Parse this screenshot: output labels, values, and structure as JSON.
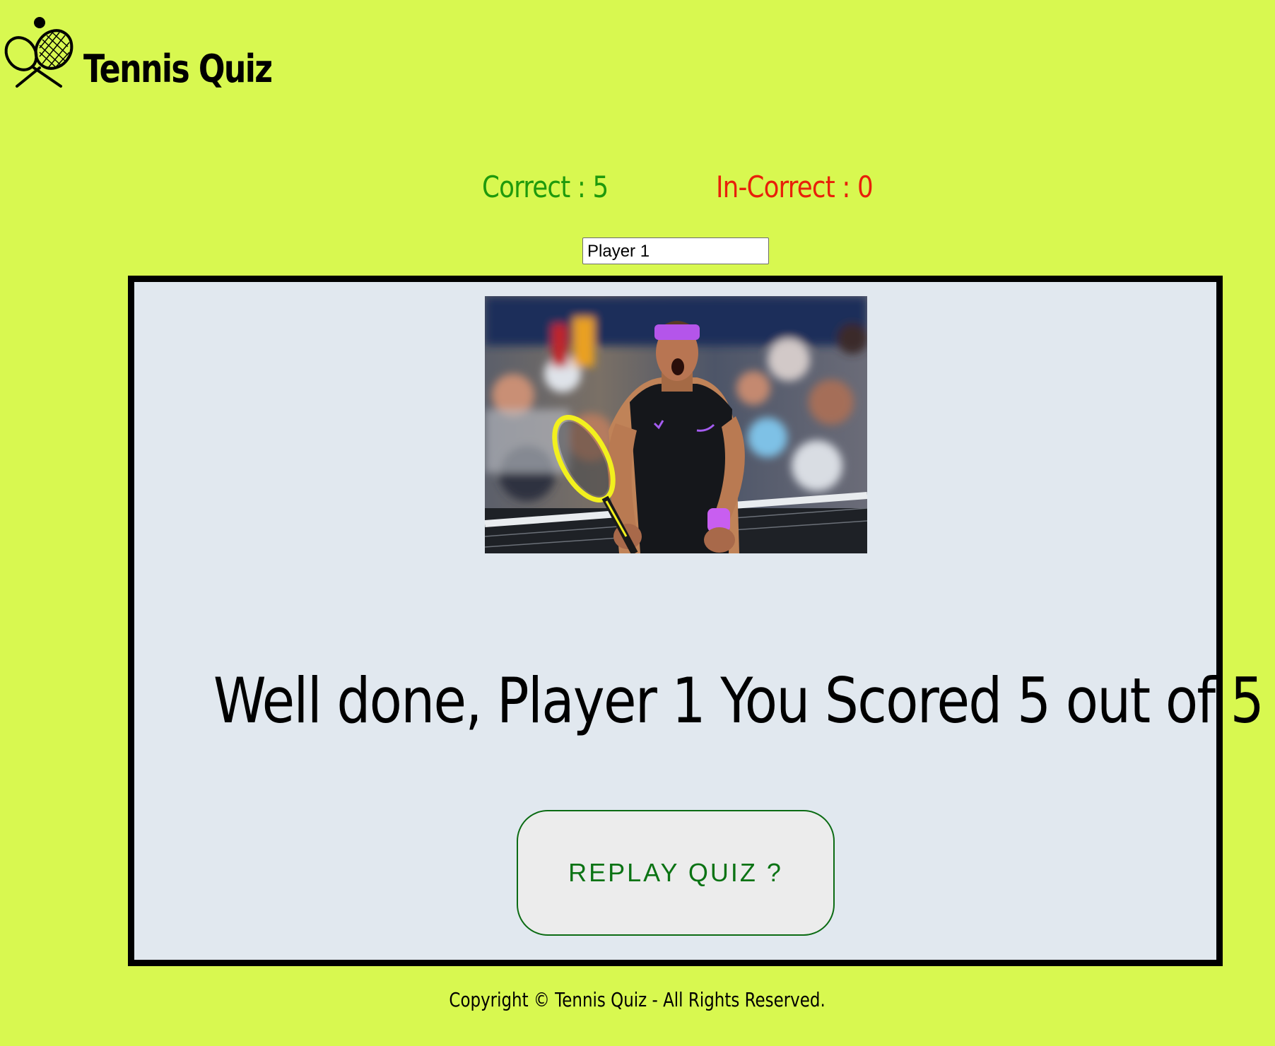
{
  "header": {
    "title": "Tennis Quiz",
    "logo_icon": "tennis-racket-ball-icon"
  },
  "score": {
    "correct_text": "Correct : 5",
    "correct_count": 5,
    "correct_color": "#1f9a0c",
    "incorrect_text": "In-Correct : 0",
    "incorrect_count": 0,
    "incorrect_color": "#e8200a"
  },
  "player": {
    "name_value": "Player 1"
  },
  "quiz": {
    "image_subject": "tennis player celebrating, purple headband, black sleeveless shirt, yellow racket",
    "result_message": "Well done, Player 1 You Scored 5 out of 5",
    "score": 5,
    "total": 5,
    "replay_label": "REPLAY QUIZ ?"
  },
  "footer": {
    "copyright": "Copyright © Tennis Quiz - All Rights Reserved."
  },
  "colors": {
    "page_background": "#d8f850",
    "quiz_background": "#e1e8ef",
    "button_text": "#0b7314"
  }
}
